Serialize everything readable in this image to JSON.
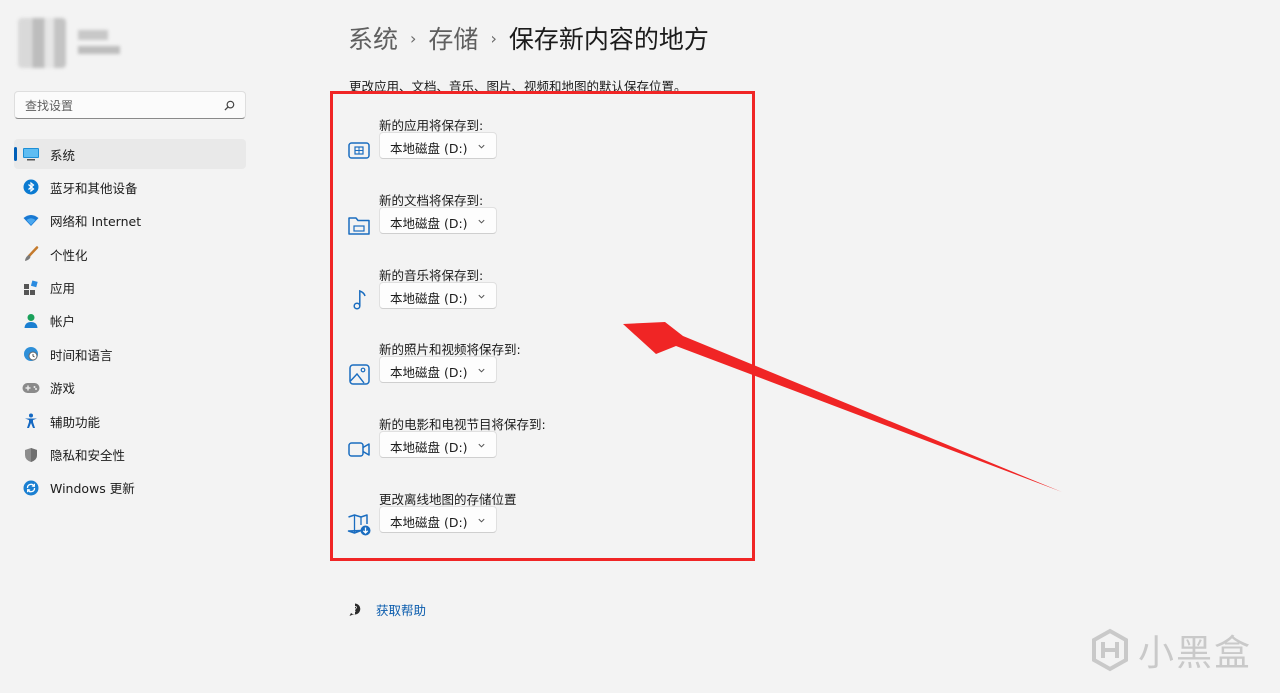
{
  "breadcrumb": {
    "items": [
      "系统",
      "存储"
    ],
    "current": "保存新内容的地方"
  },
  "search": {
    "placeholder": "查找设置"
  },
  "sidebar": {
    "items": [
      {
        "label": "系统",
        "icon": "system-icon",
        "active": true
      },
      {
        "label": "蓝牙和其他设备",
        "icon": "bluetooth-icon"
      },
      {
        "label": "网络和 Internet",
        "icon": "wifi-icon"
      },
      {
        "label": "个性化",
        "icon": "brush-icon"
      },
      {
        "label": "应用",
        "icon": "apps-icon"
      },
      {
        "label": "帐户",
        "icon": "account-icon"
      },
      {
        "label": "时间和语言",
        "icon": "globe-clock-icon"
      },
      {
        "label": "游戏",
        "icon": "gamepad-icon"
      },
      {
        "label": "辅助功能",
        "icon": "accessibility-icon"
      },
      {
        "label": "隐私和安全性",
        "icon": "shield-icon"
      },
      {
        "label": "Windows 更新",
        "icon": "update-icon"
      }
    ]
  },
  "main": {
    "subtitle": "更改应用、文档、音乐、图片、视频和地图的默认保存位置。",
    "settings": [
      {
        "label": "新的应用将保存到:",
        "value": "本地磁盘 (D:)",
        "icon": "app-window-icon"
      },
      {
        "label": "新的文档将保存到:",
        "value": "本地磁盘 (D:)",
        "icon": "folder-document-icon"
      },
      {
        "label": "新的音乐将保存到:",
        "value": "本地磁盘 (D:)",
        "icon": "music-note-icon"
      },
      {
        "label": "新的照片和视频将保存到:",
        "value": "本地磁盘 (D:)",
        "icon": "photo-icon"
      },
      {
        "label": "新的电影和电视节目将保存到:",
        "value": "本地磁盘 (D:)",
        "icon": "video-camera-icon"
      },
      {
        "label": "更改离线地图的存储位置",
        "value": "本地磁盘 (D:)",
        "icon": "map-download-icon"
      }
    ],
    "help": "获取帮助"
  },
  "watermark": {
    "text": "小黑盒"
  },
  "colors": {
    "accent": "#005fb8",
    "link": "#0b5cad",
    "annotation": "#f02525",
    "background": "#f3f3f3"
  }
}
